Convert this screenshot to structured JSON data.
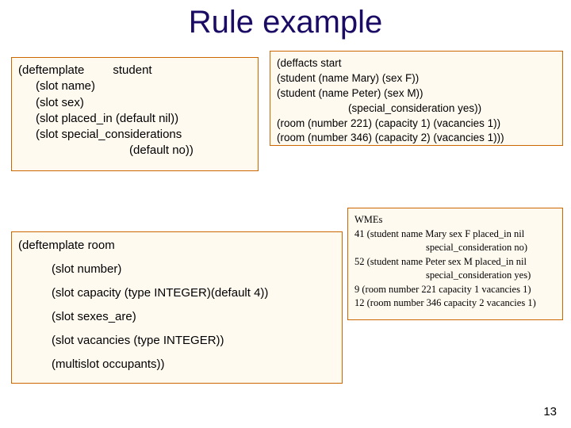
{
  "title": "Rule example",
  "student": {
    "l1a": "(deftemplate",
    "l1b": "student",
    "l2": "(slot name)",
    "l3": "(slot sex)",
    "l4": "(slot placed_in (default nil))",
    "l5": "(slot special_considerations",
    "l6": "(default no))"
  },
  "room": {
    "l1a": "(deftemplate",
    "l1b": "room",
    "l2": "(slot number)",
    "l3": "(slot capacity (type INTEGER)(default 4))",
    "l4": "(slot sexes_are)",
    "l5": "(slot vacancies (type INTEGER))",
    "l6": "(multislot occupants))"
  },
  "facts": {
    "l1": "(deffacts start",
    "l2": "(student (name Mary) (sex F))",
    "l3": "(student (name Peter) (sex M))",
    "l4": "(special_consideration yes))",
    "l5": "(room (number 221) (capacity 1) (vacancies 1))",
    "l6": "(room (number 346) (capacity 2) (vacancies 1)))"
  },
  "wmes": {
    "h": "WMEs",
    "l1": "41 (student name Mary sex F placed_in nil",
    "l1b": "special_consideration no)",
    "l2": "52 (student name Peter sex M placed_in nil",
    "l2b": "special_consideration yes)",
    "l3": "9 (room number 221 capacity 1 vacancies 1)",
    "l4": "12 (room number 346 capacity 2 vacancies 1)"
  },
  "pagenum": "13"
}
